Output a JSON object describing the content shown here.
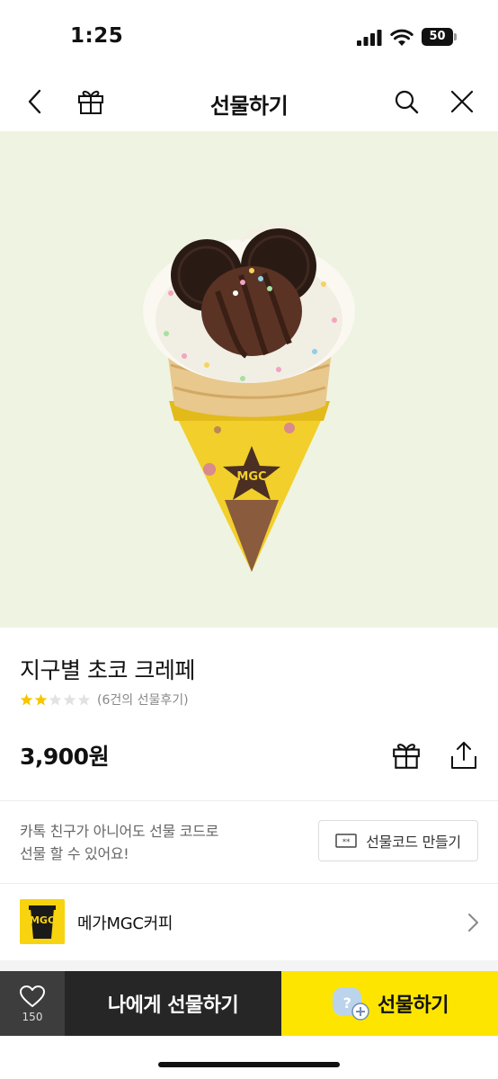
{
  "status_bar": {
    "time": "1:25",
    "battery_level": "50",
    "icons": [
      "signal-icon",
      "wifi-icon",
      "battery-icon"
    ]
  },
  "nav": {
    "title": "선물하기",
    "icons": [
      "back-icon",
      "gift-box-icon",
      "search-icon",
      "close-icon"
    ]
  },
  "product": {
    "image": "crepe-ice-cream-cone-image",
    "name": "지구별 초코 크레페",
    "rating": {
      "filled_stars": 2,
      "total_stars": 5,
      "review_text": "(6건의 선물후기)"
    },
    "price": "3,900원",
    "actions": [
      "gift-box-icon",
      "share-icon"
    ]
  },
  "gift_code": {
    "notice_line1": "카톡 친구가 아니어도 선물 코드로",
    "notice_line2": "선물 할 수 있어요!",
    "button_label": "선물코드 만들기",
    "button_icon": "ticket-icon"
  },
  "brand": {
    "logo_text": "MGC",
    "name": "메가MGC커피",
    "icon": "chevron-right-icon"
  },
  "bottom_bar": {
    "wish_count": "150",
    "self_gift_label": "나에게 선물하기",
    "gift_label": "선물하기",
    "icons": [
      "heart-icon",
      "friend-add-icon"
    ]
  },
  "colors": {
    "hero_background": "#eff3e2",
    "kakao_yellow": "#fee500",
    "dark_button": "#262626",
    "wish_button": "#3d3d3d",
    "star_filled": "#f7c600",
    "star_empty": "#e2e2e2",
    "brand_yellow": "#f8d30f"
  }
}
